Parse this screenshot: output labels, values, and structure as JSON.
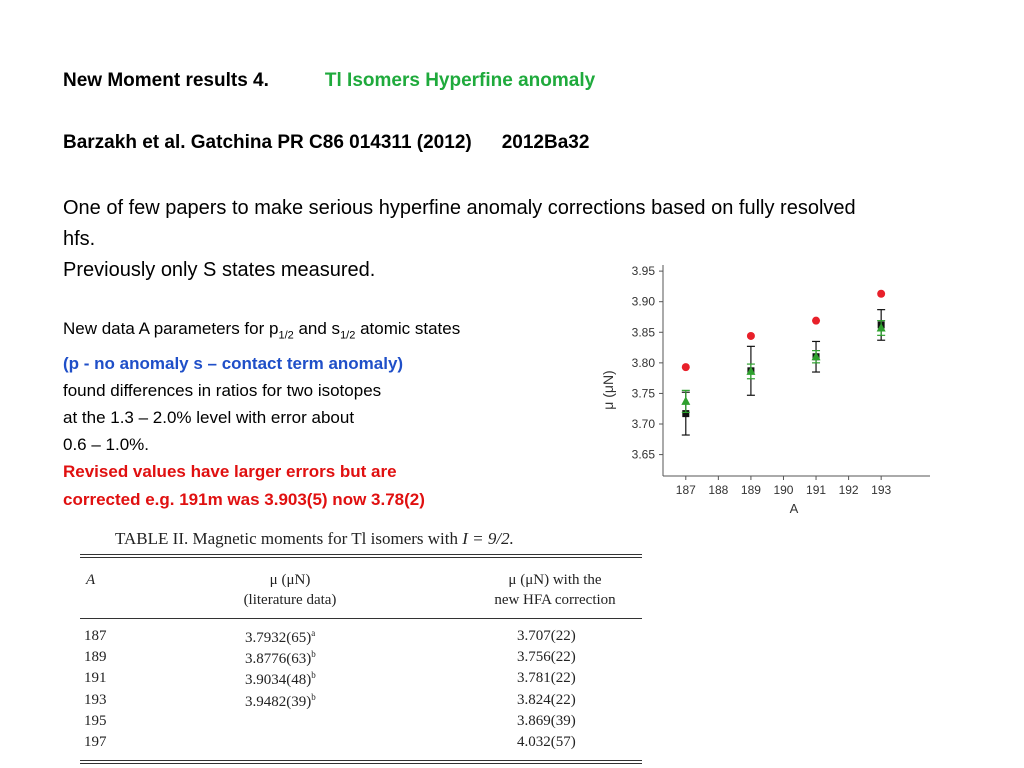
{
  "title": {
    "main": "New Moment results 4.",
    "sub": "Tl Isomers Hyperfine anomaly"
  },
  "reference": {
    "citation": "Barzakh et al. Gatchina PR C86 014311 (2012)",
    "key": "2012Ba32"
  },
  "intro": {
    "line1": "One of few papers to make serious hyperfine anomaly corrections based on fully resolved hfs.",
    "line2": "Previously only S states measured."
  },
  "details": {
    "l1_pre": "New data A parameters for p",
    "l1_sub1": "1/2",
    "l1_mid": " and s",
    "l1_sub2": "1/2",
    "l1_post": " atomic states",
    "l2": "(p - no anomaly  s – contact term anomaly)",
    "l3": "found differences in ratios for two isotopes",
    "l4": "at the 1.3 – 2.0% level with error about",
    "l5": "0.6 – 1.0%.",
    "l6": "Revised values have larger errors but are",
    "l7": "corrected e.g. 191m was 3.903(5) now 3.78(2)"
  },
  "colors": {
    "green_title": "#1faa3c",
    "blue": "#1f4fc8",
    "red": "#e01010"
  },
  "chart_data": {
    "type": "scatter",
    "xlabel": "A",
    "ylabel": "μ (μN)",
    "xlim": [
      186.3,
      194.5
    ],
    "ylim": [
      3.615,
      3.96
    ],
    "x_ticks": [
      187,
      188,
      189,
      190,
      191,
      192,
      193
    ],
    "y_ticks": [
      3.65,
      3.7,
      3.75,
      3.8,
      3.85,
      3.9,
      3.95
    ],
    "grid": false,
    "series": [
      {
        "marker": "circle",
        "color": "#e8202a",
        "points": [
          {
            "x": 187,
            "y": 3.793
          },
          {
            "x": 189,
            "y": 3.844
          },
          {
            "x": 191,
            "y": 3.869
          },
          {
            "x": 193,
            "y": 3.913
          }
        ]
      },
      {
        "marker": "square",
        "color": "#111111",
        "points": [
          {
            "x": 187,
            "y": 3.717,
            "err": 0.035
          },
          {
            "x": 189,
            "y": 3.787,
            "err": 0.04
          },
          {
            "x": 191,
            "y": 3.81,
            "err": 0.025
          },
          {
            "x": 193,
            "y": 3.862,
            "err": 0.025
          }
        ]
      },
      {
        "marker": "triangle",
        "color": "#2ea02e",
        "points": [
          {
            "x": 187,
            "y": 3.737,
            "err": 0.018
          },
          {
            "x": 189,
            "y": 3.786,
            "err": 0.012
          },
          {
            "x": 191,
            "y": 3.81,
            "err": 0.01
          },
          {
            "x": 193,
            "y": 3.857,
            "err": 0.012
          }
        ]
      }
    ]
  },
  "table": {
    "caption_pre": "TABLE II.  Magnetic moments for Tl isomers with ",
    "caption_math": "I = 9/2.",
    "col1": "A",
    "col2_l1": "μ (μN)",
    "col2_l2": "(literature data)",
    "col3_l1": "μ (μN) with the",
    "col3_l2": "new HFA correction",
    "rows": [
      {
        "a": "187",
        "lit": "3.7932(65)",
        "sup": "a",
        "hfa": "3.707(22)"
      },
      {
        "a": "189",
        "lit": "3.8776(63)",
        "sup": "b",
        "hfa": "3.756(22)"
      },
      {
        "a": "191",
        "lit": "3.9034(48)",
        "sup": "b",
        "hfa": "3.781(22)"
      },
      {
        "a": "193",
        "lit": "3.9482(39)",
        "sup": "b",
        "hfa": "3.824(22)"
      },
      {
        "a": "195",
        "lit": "",
        "sup": "",
        "hfa": "3.869(39)"
      },
      {
        "a": "197",
        "lit": "",
        "sup": "",
        "hfa": "4.032(57)"
      }
    ]
  }
}
